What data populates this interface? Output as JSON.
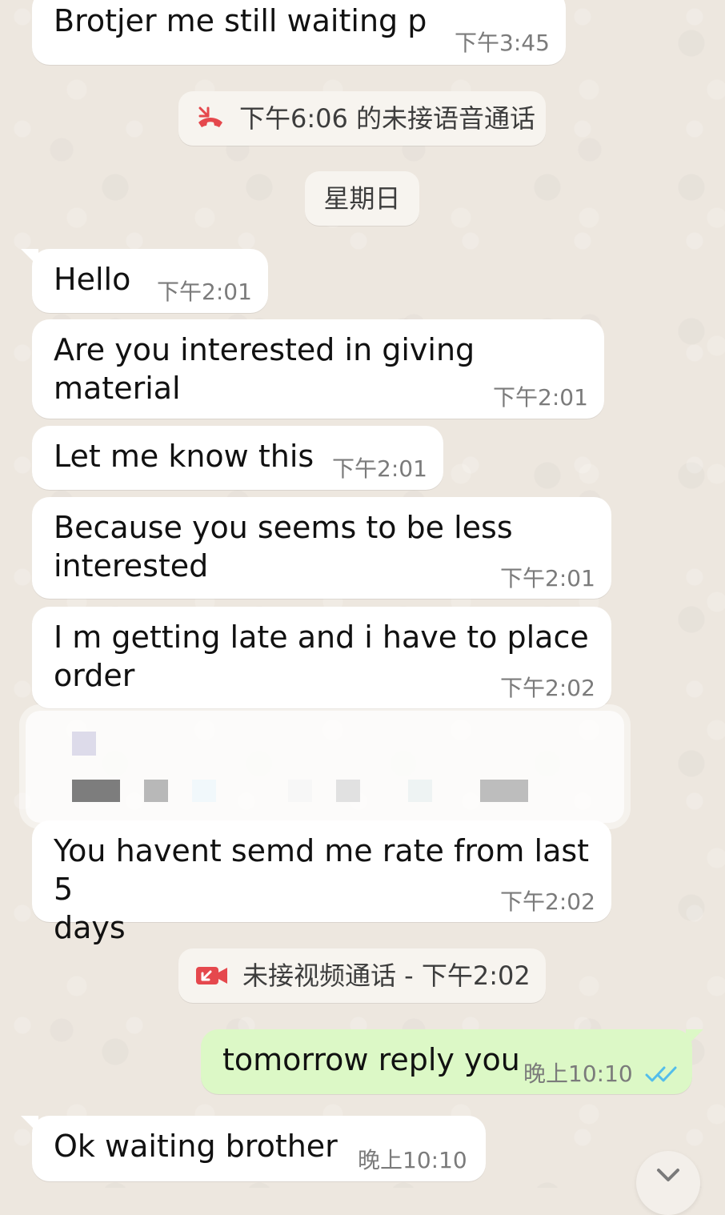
{
  "colors": {
    "incoming_bubble": "#ffffff",
    "outgoing_bubble": "#dcf8c6",
    "system_chip": "#f7f4ef",
    "missed_call_red": "#e5484d",
    "read_receipt_blue": "#53bdeb"
  },
  "messages": [
    {
      "text": "Brotjer me still waiting p",
      "time": "下午3:45"
    },
    {
      "text": "Hello",
      "time": "下午2:01"
    },
    {
      "text": "Are you interested in giving material",
      "time": "下午2:01"
    },
    {
      "text": "Let me know this",
      "time": "下午2:01"
    },
    {
      "text": "Because you seems to be less\ninterested",
      "time": "下午2:01"
    },
    {
      "text": "I m getting late and i have to place\norder",
      "time": "下午2:02"
    },
    {
      "text": "You havent semd me rate from last 5\ndays",
      "time": "下午2:02"
    },
    {
      "text": "tomorrow reply you",
      "time": "晚上10:10"
    },
    {
      "text": "Ok waiting brother",
      "time": "晚上10:10"
    }
  ],
  "system_events": {
    "missed_voice_call": "下午6:06 的未接语音通话",
    "date_separator": "星期日",
    "missed_video_call": "未接视频通话 - 下午2:02"
  },
  "icons": {
    "missed_voice_call": "missed-voice-call-icon",
    "missed_video_call": "missed-video-call-icon",
    "read_receipt": "double-check-icon",
    "scroll_down": "chevron-down-icon"
  }
}
